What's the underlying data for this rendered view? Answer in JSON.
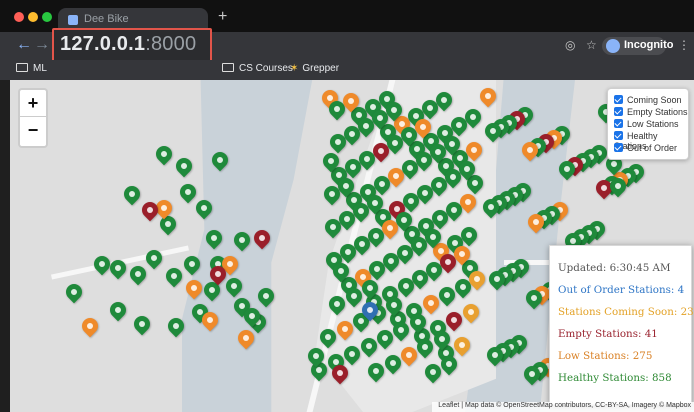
{
  "browser": {
    "tab_title": "Dee Bike",
    "new_tab_symbol": "+",
    "back_symbol": "←",
    "forward_symbol": "→",
    "url_host": "127.0.0.1",
    "url_port": ":8000",
    "incognito_label": "Incognito",
    "menu_symbol": "⋮",
    "star_symbol": "☆",
    "eye_slash_symbol": "◎"
  },
  "bookmarks": [
    {
      "label": "ML"
    },
    {
      "label": "CS Courses"
    },
    {
      "label": "Grepper"
    }
  ],
  "map": {
    "zoom_in": "+",
    "zoom_out": "−",
    "layers": [
      {
        "label": "Coming Soon",
        "checked": true
      },
      {
        "label": "Empty Stations",
        "checked": true
      },
      {
        "label": "Low Stations",
        "checked": true
      },
      {
        "label": "Healthy Stations",
        "checked": true
      },
      {
        "label": "Out of Order",
        "checked": true
      }
    ],
    "stats": {
      "updated": "Updated: 6:30:45 AM",
      "out_of_order": "Out of Order Stations: 4",
      "coming_soon": "Stations Coming Soon: 23",
      "empty": "Empty Stations: 41",
      "low": "Low Stations: 275",
      "healthy": "Healthy Stations: 858"
    },
    "attribution": "Leaflet | Map data © OpenStreetMap contributors, CC-BY-SA, Imagery © Mapbox",
    "colors": {
      "healthy": "#1f8a3b",
      "low": "#ef8a2a",
      "empty": "#9a1f2a",
      "coming": "#e8a030",
      "out_of_order": "#2f6fb2",
      "updated": "#555555",
      "healthy_text": "#2f8a35",
      "low_text": "#d98024",
      "empty_text": "#9a2430",
      "coming_text": "#e3a227",
      "out_text": "#2f76c6"
    }
  }
}
